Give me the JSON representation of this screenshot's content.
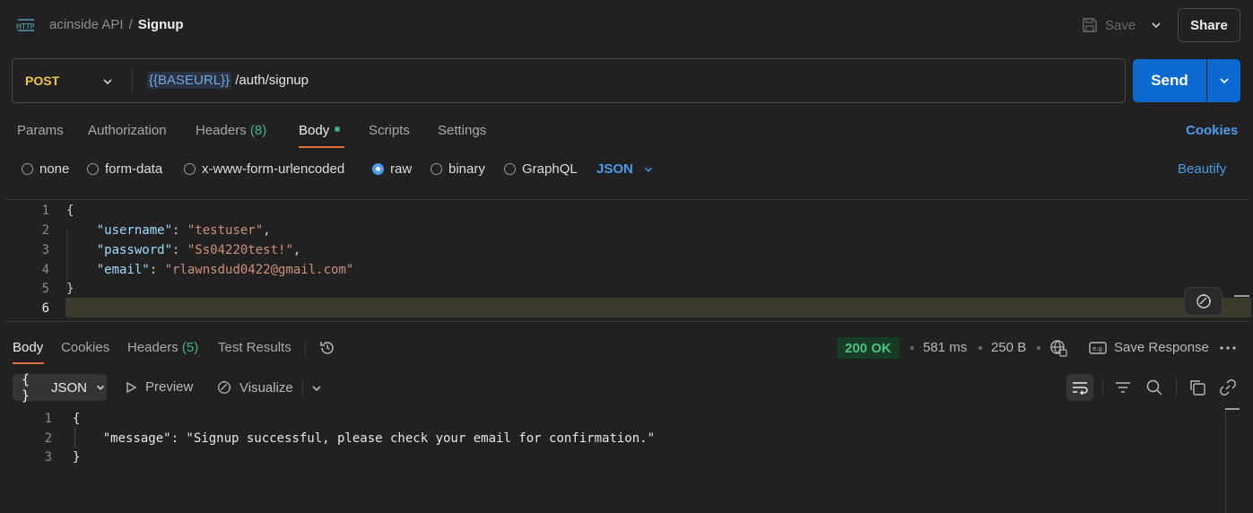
{
  "header": {
    "collection": "acinside API",
    "separator": "/",
    "request_name": "Signup",
    "save_label": "Save",
    "share_label": "Share",
    "http_icon": "http-icon"
  },
  "request": {
    "method": "POST",
    "url_variable": "{{BASEURL}}",
    "url_path": " /auth/signup",
    "send_label": "Send"
  },
  "request_tabs": {
    "params": "Params",
    "authorization": "Authorization",
    "headers": "Headers",
    "headers_count": "(8)",
    "body": "Body",
    "scripts": "Scripts",
    "settings": "Settings",
    "cookies": "Cookies"
  },
  "body_types": {
    "none": "none",
    "form_data": "form-data",
    "urlencoded": "x-www-form-urlencoded",
    "raw": "raw",
    "binary": "binary",
    "graphql": "GraphQL",
    "selected": "raw",
    "language": "JSON",
    "beautify": "Beautify"
  },
  "request_body": {
    "line_numbers": [
      "1",
      "2",
      "3",
      "4",
      "5",
      "6"
    ],
    "open_brace": "{",
    "close_brace": "}",
    "fields": [
      {
        "key": "\"username\"",
        "value": "\"testuser\"",
        "trail": ","
      },
      {
        "key": "\"password\"",
        "value": "\"Ss04220test!\"",
        "trail": ","
      },
      {
        "key": "\"email\"",
        "value": "\"rlawnsdud0422@gmail.com\"",
        "trail": ""
      }
    ]
  },
  "response_tabs": {
    "body": "Body",
    "cookies": "Cookies",
    "headers": "Headers",
    "headers_count": "(5)",
    "test_results": "Test Results"
  },
  "response_meta": {
    "status": "200 OK",
    "time": "581 ms",
    "size": "250 B",
    "save_response": "Save Response"
  },
  "response_toolbar": {
    "format_braces": "{ }",
    "format": "JSON",
    "preview": "Preview",
    "visualize": "Visualize"
  },
  "response_body": {
    "line_numbers": [
      "1",
      "2",
      "3"
    ],
    "open_brace": "{",
    "line2": "    \"message\": \"Signup successful, please check your email for confirmation.\"",
    "close_brace": "}"
  },
  "colors": {
    "accent_blue": "#0c69cf",
    "method_post": "#f0c44a",
    "status_ok": "#4cc17f",
    "tab_underline": "#e0703a"
  }
}
